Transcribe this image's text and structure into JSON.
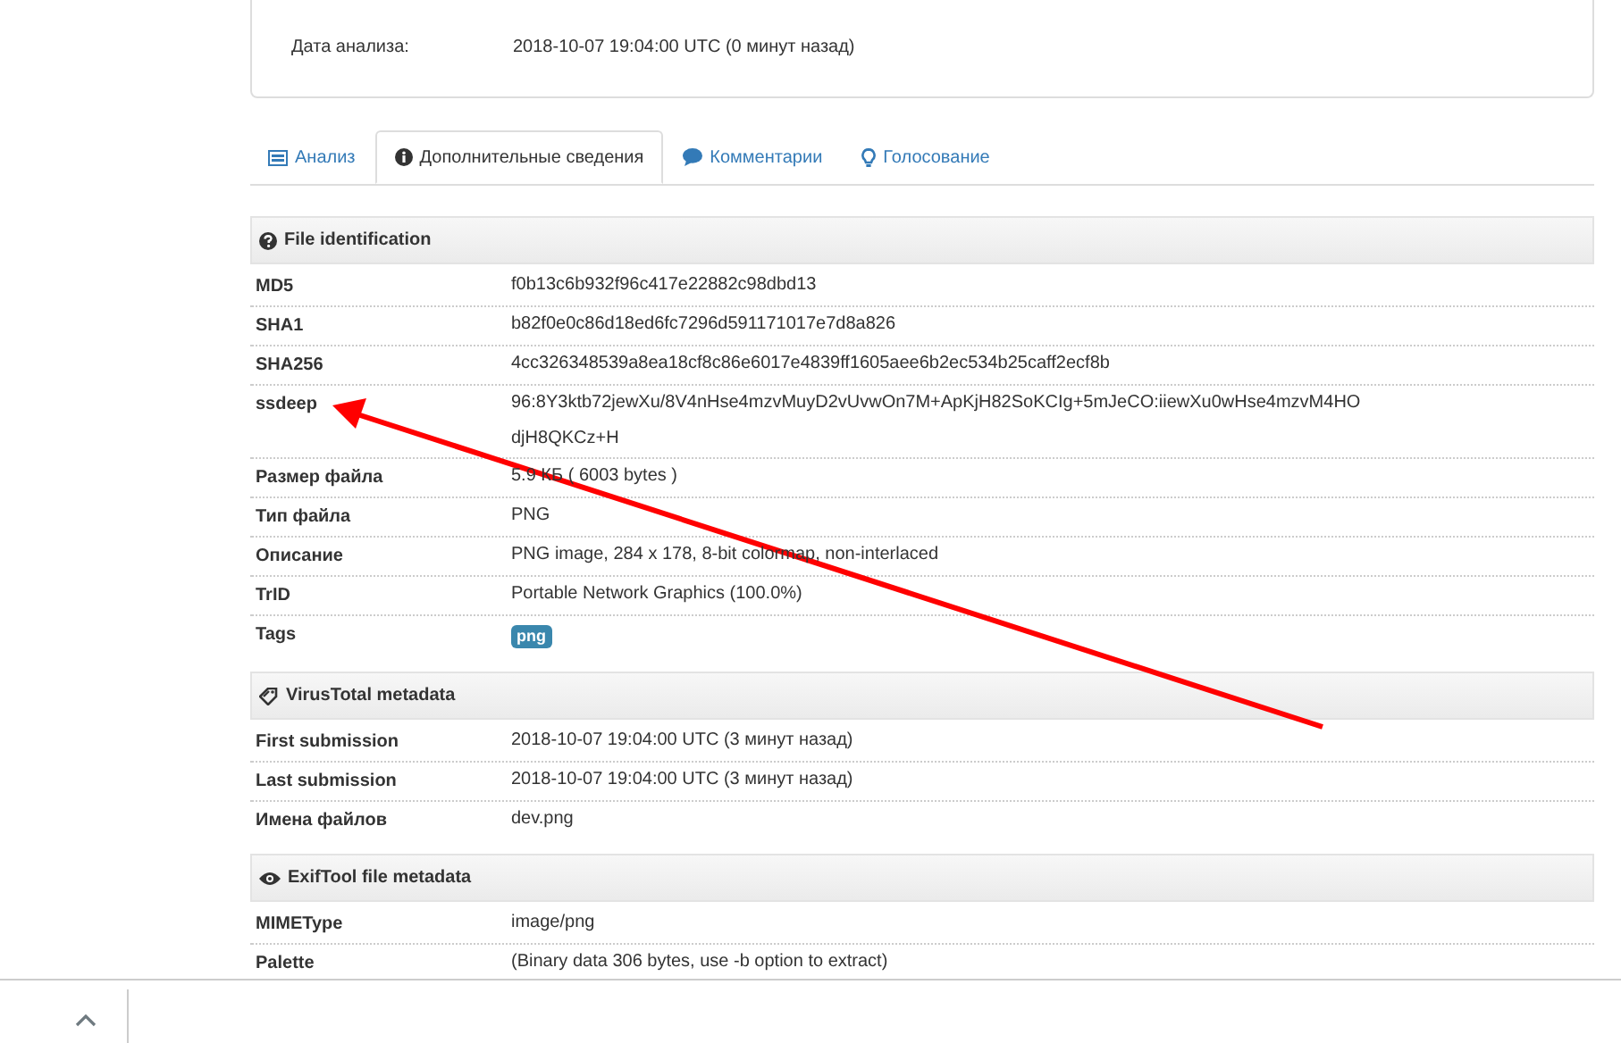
{
  "analysis_card": {
    "fields": [
      {
        "label": "Дата анализа:",
        "value": "2018-10-07 19:04:00 UTC (0 минут назад)"
      }
    ]
  },
  "tabs": [
    {
      "label": "Анализ",
      "selected": false
    },
    {
      "label": "Дополнительные сведения",
      "selected": true
    },
    {
      "label": "Комментарии",
      "selected": false
    },
    {
      "label": "Голосование",
      "selected": false
    }
  ],
  "sections": [
    {
      "title": "File identification",
      "rows": [
        {
          "kind": "text",
          "label": "MD5",
          "value": "f0b13c6b932f96c417e22882c98dbd13"
        },
        {
          "kind": "text",
          "label": "SHA1",
          "value": "b82f0e0c86d18ed6fc7296d591171017e7d8a826"
        },
        {
          "kind": "text",
          "label": "SHA256",
          "value": "4cc326348539a8ea18cf8c86e6017e4839ff1605aee6b2ec534b25caff2ecf8b"
        },
        {
          "kind": "text",
          "label": "ssdeep",
          "value": "96:8Y3ktb72jewXu/8V4nHse4mzvMuyD2vUvwOn7M+ApKjH82SoKCIg+5mJeCO:iiewXu0wHse4mzvM4HOdjH8QKCz+H"
        },
        {
          "kind": "text",
          "label": "Размер файла",
          "value": "5.9 КБ ( 6003 bytes )"
        },
        {
          "kind": "text",
          "label": "Тип файла",
          "value": "PNG"
        },
        {
          "kind": "text",
          "label": "Описание",
          "value": "PNG image, 284 x 178, 8-bit colormap, non-interlaced"
        },
        {
          "kind": "text",
          "label": "TrID",
          "value": "Portable Network Graphics (100.0%)"
        },
        {
          "kind": "tags",
          "label": "Tags",
          "tags": [
            "png"
          ]
        }
      ]
    },
    {
      "title": "VirusTotal metadata",
      "rows": [
        {
          "kind": "text",
          "label": "First submission",
          "value": "2018-10-07 19:04:00 UTC (3 минут назад)"
        },
        {
          "kind": "text",
          "label": "Last submission",
          "value": "2018-10-07 19:04:00 UTC (3 минут назад)"
        },
        {
          "kind": "text",
          "label": "Имена файлов",
          "value": "dev.png"
        }
      ]
    },
    {
      "title": "ExifTool file metadata",
      "rows": [
        {
          "kind": "text",
          "label": "MIMEType",
          "value": "image/png"
        },
        {
          "kind": "text",
          "label": "Palette",
          "value": "(Binary data 306 bytes, use -b option to extract)"
        }
      ]
    }
  ]
}
